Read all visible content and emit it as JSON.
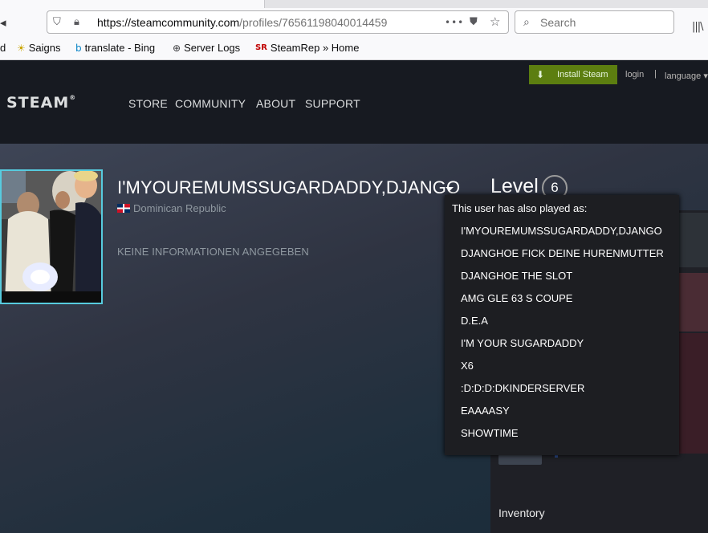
{
  "browser": {
    "url_host": "https://steamcommunity.com",
    "url_path": "/profiles/76561198040014459",
    "search_placeholder": "Search",
    "bookmarks": [
      {
        "label": "d"
      },
      {
        "label": "Saigns"
      },
      {
        "label": "translate - Bing"
      },
      {
        "label": "Server Logs"
      },
      {
        "label": "SteamRep » Home"
      }
    ],
    "steamrep_icon": "SR"
  },
  "steam": {
    "logo": "STEAM",
    "logo_mark": "®",
    "nav": [
      "STORE",
      "COMMUNITY",
      "ABOUT",
      "SUPPORT"
    ],
    "install_button": "Install Steam",
    "login": "login",
    "separator": "|",
    "language": "language"
  },
  "profile": {
    "persona_name": "I'MYOUREMUMSSUGARDADDY,DJANGO",
    "country": "Dominican Republic",
    "no_info": "KEINE INFORMATIONEN ANGEGEBEN",
    "level_label": "Level",
    "level": "6",
    "inventory_label": "Inventory"
  },
  "aliases_popup": {
    "title": "This user has also played as:",
    "names": [
      "I'MYOUREMUMSSUGARDADDY,DJANGO",
      "DJANGHOE FICK DEINE HURENMUTTER",
      "DJANGHOE THE SLOT",
      "AMG GLE 63 S COUPE",
      "D.E.A",
      "I'M YOUR SUGARDADDY",
      "X6",
      ":D:D:D:DKINDERSERVER",
      "EAAAASY",
      "SHOWTIME"
    ]
  },
  "colors": {
    "install_green": "#5c7e10",
    "header_bg": "#171a21",
    "avatar_border": "#57cbde"
  }
}
